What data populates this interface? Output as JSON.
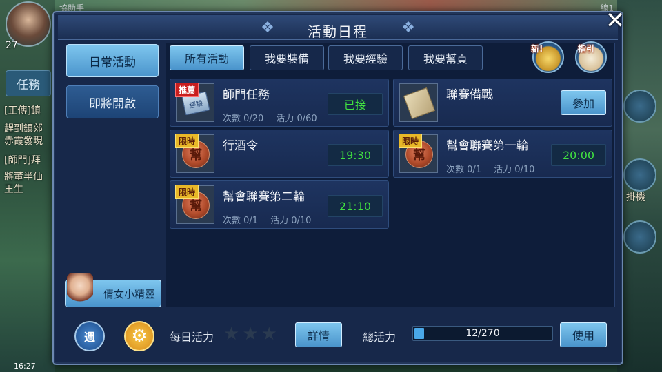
{
  "background": {
    "top_left_text": "協助手",
    "top_right_text": "線1",
    "level": "27",
    "task_tab": "任務",
    "chat_lines": [
      "[正傳]鎮",
      "趕到鎮郊",
      "赤霞發現",
      "[師門]拜",
      "將董半仙",
      "王生"
    ],
    "right_label": "掛機",
    "clock": "16:27"
  },
  "dialog": {
    "title": "活動日程",
    "close_label": "✕"
  },
  "categories": [
    {
      "label": "日常活動",
      "active": true
    },
    {
      "label": "即將開啟",
      "active": false
    }
  ],
  "fairy_label": "倩女小精靈",
  "tabs": [
    {
      "label": "所有活動",
      "active": true
    },
    {
      "label": "我要裝備",
      "active": false
    },
    {
      "label": "我要經驗",
      "active": false
    },
    {
      "label": "我要幫貢",
      "active": false
    }
  ],
  "corner_icons": {
    "new_label": "新!",
    "guide_label": "指引"
  },
  "activities": [
    {
      "name": "師門任務",
      "badge": "推薦",
      "icon_text": "經驗",
      "count": "次數 0/20",
      "vitality": "活力 0/60",
      "status": "已接"
    },
    {
      "name": "聯賽備戰",
      "action": "參加"
    },
    {
      "name": "行酒令",
      "badge": "限時",
      "icon_text": "幫",
      "status": "19:30"
    },
    {
      "name": "幫會聯賽第一輪",
      "badge": "限時",
      "icon_text": "幫",
      "count": "次數 0/1",
      "vitality": "活力 0/10",
      "status": "20:00"
    },
    {
      "name": "幫會聯賽第二輪",
      "badge": "限時",
      "icon_text": "幫",
      "count": "次數 0/1",
      "vitality": "活力 0/10",
      "status": "21:10"
    }
  ],
  "bottom": {
    "week_label": "週",
    "daily_vitality_label": "每日活力",
    "stars_filled": 0,
    "stars_total": 3,
    "details_button": "詳情",
    "total_vitality_label": "總活力",
    "progress_text": "12/270",
    "progress_fraction": 0.044,
    "use_button": "使用"
  },
  "colors": {
    "accent_blue": "#4a94cc",
    "status_green": "#40e040",
    "badge_red": "#c81e1e",
    "badge_gold": "#e8b828"
  }
}
